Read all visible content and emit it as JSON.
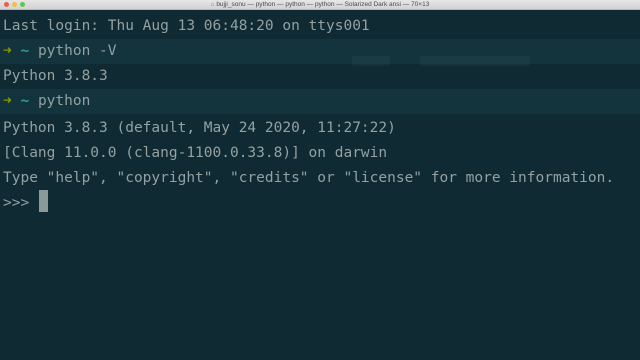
{
  "window": {
    "title": "bujji_sonu — python — python — python — Solarized Dark ansi — 70×13",
    "home_icon": "home-icon",
    "colors": {
      "background": "#0f2a33",
      "text": "#93a1a1",
      "prompt_arrow": "#859900",
      "prompt_tilde": "#2aa198"
    }
  },
  "terminal": {
    "last_login": "Last login: Thu Aug 13 06:48:20 on ttys001",
    "prompt_arrow": "➜",
    "prompt_dir": "~",
    "cmd1": "python -V",
    "out1": "Python 3.8.3",
    "cmd2": "python",
    "banner1": "Python 3.8.3 (default, May 24 2020, 11:27:22)",
    "banner2": "[Clang 11.0.0 (clang-1100.0.33.8)] on darwin",
    "banner3": "Type \"help\", \"copyright\", \"credits\" or \"license\" for more information.",
    "repl_prompt": ">>> "
  }
}
